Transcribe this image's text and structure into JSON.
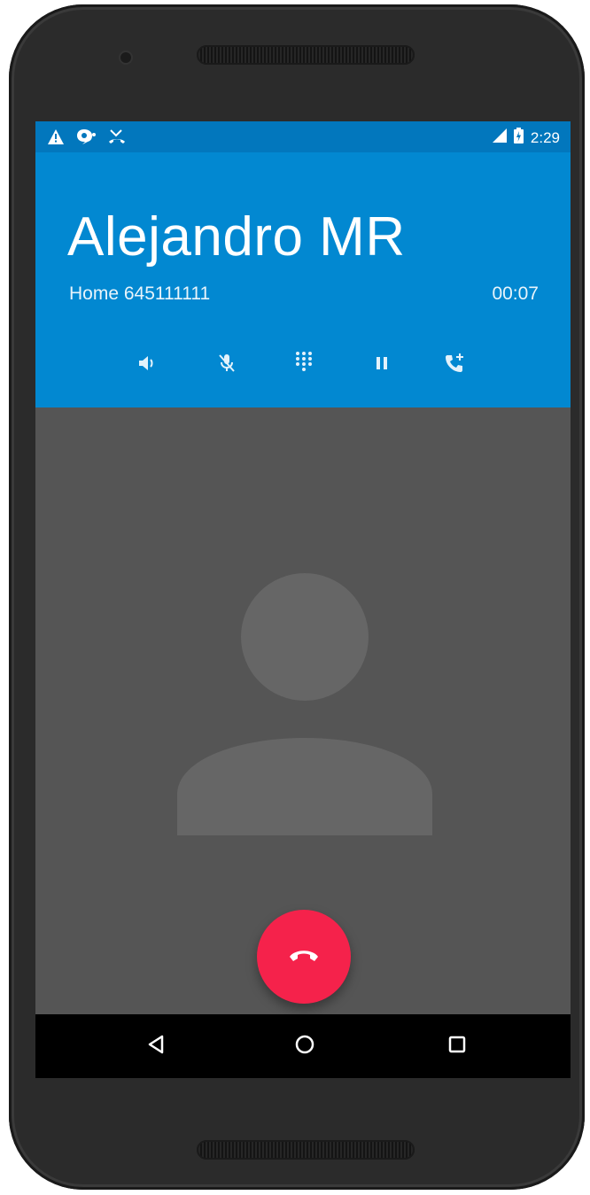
{
  "status_bar": {
    "time": "2:29",
    "left_icons": [
      "warning-icon",
      "chat-bubble-icon",
      "missed-call-icon"
    ],
    "right_icons": [
      "signal-icon",
      "battery-icon"
    ]
  },
  "call": {
    "caller_name": "Alejandro MR",
    "number_label": "Home 645111111",
    "duration": "00:07",
    "controls": [
      "speaker-icon",
      "mute-mic-icon",
      "dialpad-icon",
      "pause-icon",
      "add-call-icon"
    ]
  },
  "nav": {
    "buttons": [
      "back-icon",
      "home-icon",
      "recents-icon"
    ]
  },
  "colors": {
    "header_blue": "#0288d1",
    "status_blue": "#0277bd",
    "end_call_red": "#f5224b",
    "background_gray": "#555555"
  }
}
